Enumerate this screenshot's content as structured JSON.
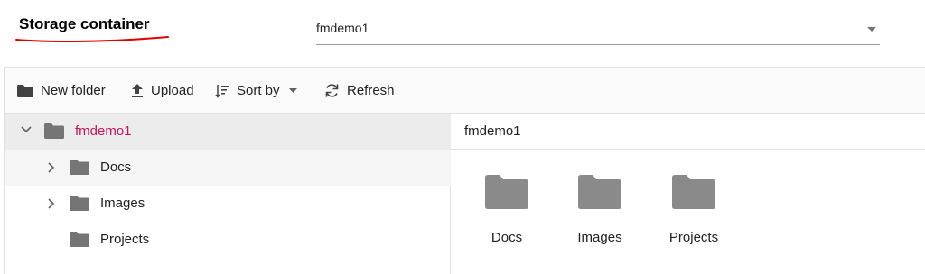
{
  "header": {
    "storage_label": "Storage container",
    "container_value": "fmdemo1",
    "accent_underline_color": "#e00000"
  },
  "toolbar": {
    "new_folder": "New folder",
    "upload": "Upload",
    "sort_by": "Sort by",
    "refresh": "Refresh"
  },
  "nav": {
    "root": {
      "label": "fmdemo1",
      "expanded": true,
      "selected": true,
      "icon": "folder-icon"
    },
    "items": [
      {
        "label": "Docs",
        "has_children": true,
        "icon": "folder-icon"
      },
      {
        "label": "Images",
        "has_children": true,
        "icon": "folder-icon"
      },
      {
        "label": "Projects",
        "has_children": false,
        "icon": "folder-icon"
      }
    ]
  },
  "content": {
    "breadcrumb": "fmdemo1",
    "tiles": [
      {
        "label": "Docs",
        "icon": "folder-icon"
      },
      {
        "label": "Images",
        "icon": "folder-icon"
      },
      {
        "label": "Projects",
        "icon": "folder-icon"
      }
    ]
  },
  "colors": {
    "selected_text": "#c2185b",
    "folder_gray": "#757575",
    "tile_folder_gray": "#8a8a8a"
  }
}
